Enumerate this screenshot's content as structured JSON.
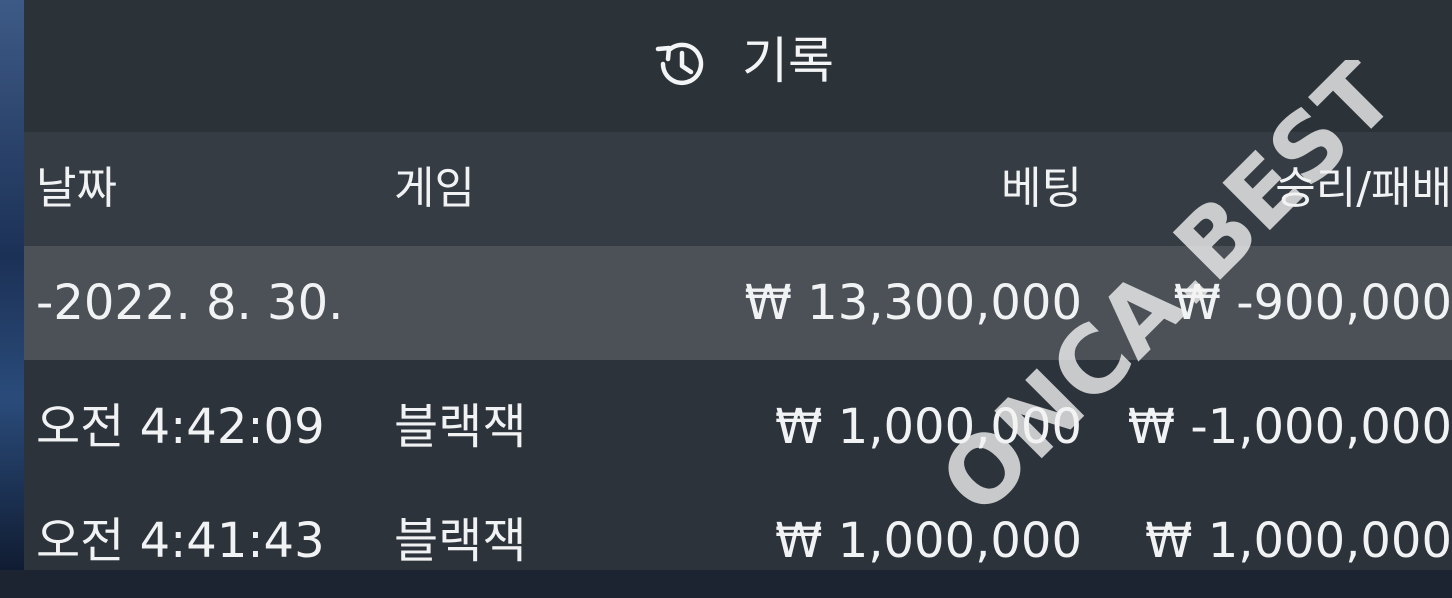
{
  "header": {
    "title": "기록",
    "icon": "history-icon"
  },
  "table": {
    "columns": {
      "date": "날짜",
      "game": "게임",
      "bet": "베팅",
      "result": "승리/패배"
    },
    "summary": {
      "date": "-2022. 8. 30.",
      "game": "",
      "bet": "₩ 13,300,000",
      "result": "₩ -900,000"
    },
    "rows": [
      {
        "time": "오전 4:42:09",
        "game": "블랙잭",
        "bet": "₩ 1,000,000",
        "result": "₩ -1,000,000"
      },
      {
        "time": "오전 4:41:43",
        "game": "블랙잭",
        "bet": "₩ 1,000,000",
        "result": "₩ 1,000,000"
      }
    ]
  },
  "watermark": {
    "text": "ONCA.BEST"
  },
  "colors": {
    "panel": "#2c333b",
    "header_row": "#353c43",
    "summary_row": "#4b5157",
    "text": "#f1f2f3"
  }
}
